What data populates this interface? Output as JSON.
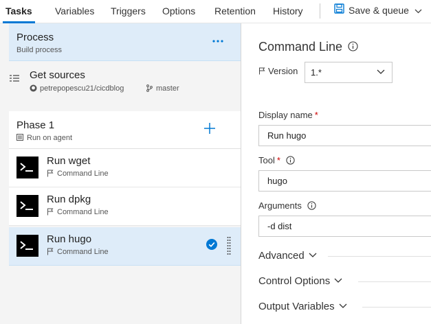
{
  "tabs": [
    {
      "label": "Tasks",
      "active": true
    },
    {
      "label": "Variables"
    },
    {
      "label": "Triggers"
    },
    {
      "label": "Options"
    },
    {
      "label": "Retention"
    },
    {
      "label": "History"
    }
  ],
  "toolbar": {
    "save_label": "Save & queue",
    "save_icon": "save-icon"
  },
  "process": {
    "title": "Process",
    "subtitle": "Build process",
    "menu_icon": "ellipsis-icon"
  },
  "sources": {
    "title": "Get sources",
    "repo": "petrepopescu21/cicdblog",
    "branch": "master"
  },
  "phase": {
    "title": "Phase 1",
    "subtitle": "Run on agent"
  },
  "tasks": [
    {
      "title": "Run wget",
      "subtitle": "Command Line",
      "selected": false
    },
    {
      "title": "Run dpkg",
      "subtitle": "Command Line",
      "selected": false
    },
    {
      "title": "Run hugo",
      "subtitle": "Command Line",
      "selected": true
    }
  ],
  "details": {
    "title": "Command Line",
    "version_label": "Version",
    "version_value": "1.*",
    "display_name_label": "Display name",
    "display_name_value": "Run hugo",
    "tool_label": "Tool",
    "tool_value": "hugo",
    "arguments_label": "Arguments",
    "arguments_value": "-d dist",
    "sections": [
      "Advanced",
      "Control Options",
      "Output Variables"
    ]
  },
  "colors": {
    "accent": "#0078d4",
    "selected_bg": "#deecf9",
    "pane_bg": "#f4f4f4",
    "required": "#cc0000"
  }
}
